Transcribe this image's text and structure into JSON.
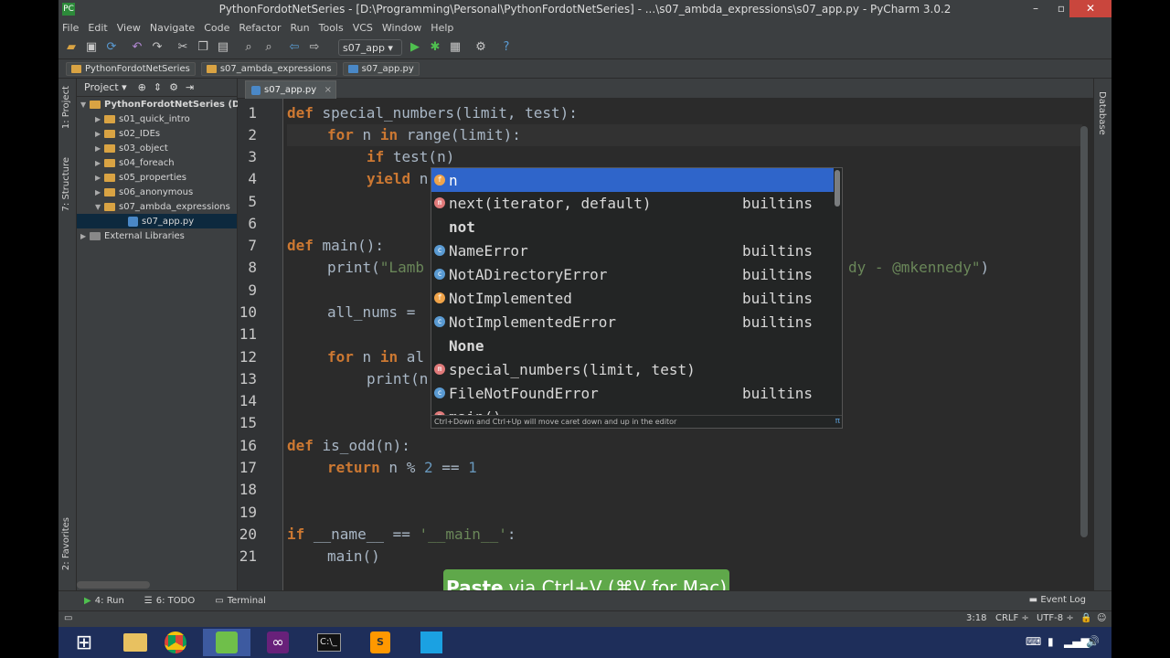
{
  "window": {
    "title": "PythonFordotNetSeries - [D:\\Programming\\Personal\\PythonFordotNetSeries] - ...\\s07_ambda_expressions\\s07_app.py - PyCharm 3.0.2",
    "icon": "PC"
  },
  "menu": [
    "File",
    "Edit",
    "View",
    "Navigate",
    "Code",
    "Refactor",
    "Run",
    "Tools",
    "VCS",
    "Window",
    "Help"
  ],
  "toolbar": {
    "run_config": "s07_app ▾",
    "help": "?"
  },
  "breadcrumbs": [
    "PythonFordotNetSeries",
    "s07_ambda_expressions",
    "s07_app.py"
  ],
  "left_strip": {
    "project_tab": "1: Project",
    "structure_tab": "7: Structure",
    "favorites_tab": "2: Favorites"
  },
  "right_strip": {
    "database_tab": "Database"
  },
  "project_panel": {
    "header": "Project ▾",
    "tree": [
      {
        "label": "PythonFordotNetSeries (D:\\",
        "kind": "root",
        "expanded": true
      },
      {
        "label": "s01_quick_intro",
        "kind": "folder"
      },
      {
        "label": "s02_IDEs",
        "kind": "folder"
      },
      {
        "label": "s03_object",
        "kind": "folder"
      },
      {
        "label": "s04_foreach",
        "kind": "folder"
      },
      {
        "label": "s05_properties",
        "kind": "folder"
      },
      {
        "label": "s06_anonymous",
        "kind": "folder"
      },
      {
        "label": "s07_ambda_expressions",
        "kind": "folder",
        "expanded": true
      },
      {
        "label": "s07_app.py",
        "kind": "file",
        "selected": true
      },
      {
        "label": "External Libraries",
        "kind": "lib"
      }
    ]
  },
  "editor": {
    "tab_label": "s07_app.py",
    "line_numbers": [
      "1",
      "2",
      "3",
      "4",
      "5",
      "6",
      "7",
      "8",
      "9",
      "10",
      "11",
      "12",
      "13",
      "14",
      "15",
      "16",
      "17",
      "18",
      "19",
      "20",
      "21"
    ],
    "lines": {
      "l1_kw": "def",
      "l1_rest": " special_numbers(limit, test):",
      "l2_kw": "for",
      "l2_mid": " n ",
      "l2_kw2": "in",
      "l2_rest": " range(limit):",
      "l3_kw": "if",
      "l3_rest": " test(n)",
      "l4_kw": "yield",
      "l4_rest": " n",
      "l7_kw": "def",
      "l7_rest": " main():",
      "l8_a": "print(",
      "l8_str": "\"Lamb",
      "l8_tail": "dy - @mkennedy\"",
      "l8_close": ")",
      "l10": "all_nums =",
      "l12_kw": "for",
      "l12_mid": " n ",
      "l12_kw2": "in",
      "l12_rest": " al",
      "l13": "print(n",
      "l16_kw": "def",
      "l16_rest": " is_odd(n):",
      "l17_kw": "return",
      "l17_a": " n % ",
      "l17_n1": "2",
      "l17_b": " == ",
      "l17_n2": "1",
      "l20_kw": "if",
      "l20_a": " __name__ == ",
      "l20_str": "'__main__'",
      "l20_b": ":",
      "l21": "main()"
    }
  },
  "completion": {
    "items": [
      {
        "icon": "f",
        "name": "n",
        "source": "",
        "selected": true
      },
      {
        "icon": "m",
        "name": "next(iterator, default)",
        "source": "builtins"
      },
      {
        "icon": "none",
        "name": "not",
        "source": ""
      },
      {
        "icon": "c",
        "name": "NameError",
        "source": "builtins"
      },
      {
        "icon": "c",
        "name": "NotADirectoryError",
        "source": "builtins"
      },
      {
        "icon": "f",
        "name": "NotImplemented",
        "source": "builtins"
      },
      {
        "icon": "c",
        "name": "NotImplementedError",
        "source": "builtins"
      },
      {
        "icon": "none",
        "name": "None",
        "source": ""
      },
      {
        "icon": "m",
        "name": "special_numbers(limit, test)",
        "source": ""
      },
      {
        "icon": "c",
        "name": "FileNotFoundError",
        "source": "builtins"
      },
      {
        "icon": "m",
        "name": "main()",
        "source": ""
      }
    ],
    "hint": "Ctrl+Down and Ctrl+Up will move caret down and up in the editor",
    "hint_symbol": "π"
  },
  "overlay": {
    "bold": "Paste",
    "rest": "via Ctrl+V (⌘V for Mac)"
  },
  "tool_windows": {
    "run": "4: Run",
    "todo": "6: TODO",
    "terminal": "Terminal",
    "event_log": "Event Log"
  },
  "status": {
    "position": "3:18",
    "line_sep": "CRLF ÷",
    "encoding": "UTF-8 ÷"
  },
  "colors": {
    "keyword": "#cc7832",
    "string": "#6a8759",
    "number": "#6897bb",
    "selection": "#2f65ca",
    "paste_badge": "#5fa84a"
  }
}
